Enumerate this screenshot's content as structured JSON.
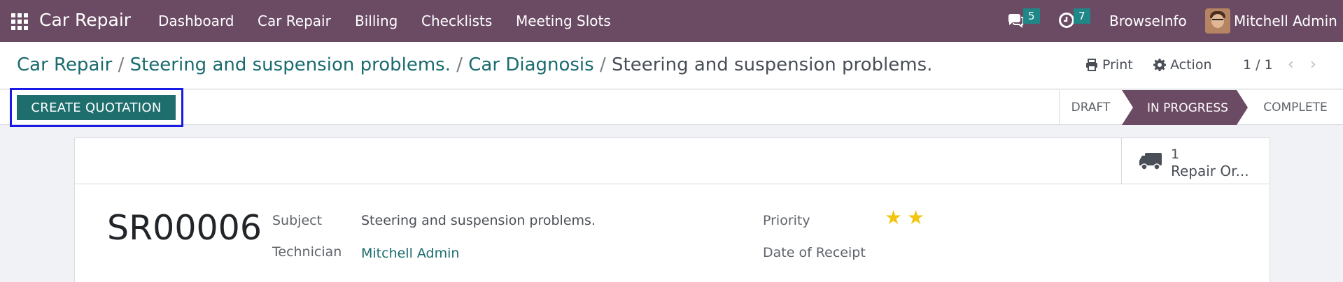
{
  "navbar": {
    "app_name": "Car Repair",
    "menus": [
      "Dashboard",
      "Car Repair",
      "Billing",
      "Checklists",
      "Meeting Slots"
    ],
    "messages_count": "5",
    "activities_count": "7",
    "company": "BrowseInfo",
    "user": "Mitchell Admin"
  },
  "breadcrumb": {
    "items": [
      "Car Repair",
      "Steering and suspension problems.",
      "Car Diagnosis"
    ],
    "separator": "/",
    "current": "Steering and suspension problems."
  },
  "actions": {
    "print_label": "Print",
    "action_label": "Action",
    "pager": "1 / 1"
  },
  "statusbar": {
    "create_quotation_label": "CREATE QUOTATION",
    "stages": [
      "DRAFT",
      "IN PROGRESS",
      "COMPLETE"
    ],
    "active_stage": "IN PROGRESS"
  },
  "smart_button": {
    "count": "1",
    "label": "Repair Or..."
  },
  "record": {
    "name": "SR00006",
    "subject_label": "Subject",
    "subject": "Steering and suspension problems.",
    "technician_label": "Technician",
    "technician": "Mitchell Admin",
    "priority_label": "Priority",
    "priority_stars": 2,
    "date_of_receipt_label": "Date of Receipt",
    "date_of_receipt": ""
  },
  "colors": {
    "navbar": "#6b4a64",
    "primary_button": "#1f6e6e",
    "link": "#1a6b6e",
    "badge": "#1f8787",
    "star": "#f3c511",
    "highlight_frame": "#1a1ae6"
  }
}
